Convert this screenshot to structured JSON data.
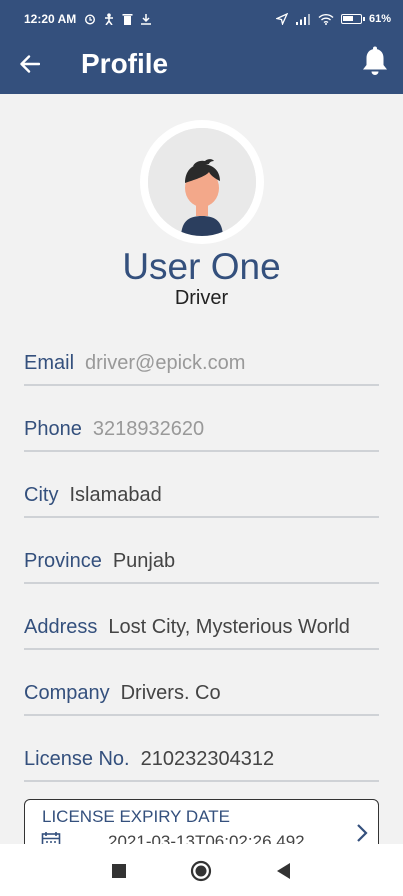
{
  "status_bar": {
    "time": "12:20 AM",
    "battery_percent": "61",
    "battery_level": 0.61,
    "left_icons": [
      "alarm-icon",
      "person-icon",
      "trash-icon",
      "download-icon"
    ],
    "right_icons": [
      "location-icon",
      "signal-icon",
      "wifi-icon",
      "battery-icon"
    ]
  },
  "app_bar": {
    "title": "Profile",
    "back_icon": "arrow-left-icon",
    "notification_icon": "bell-icon",
    "color": "#34507d"
  },
  "profile": {
    "name": "User One",
    "role": "Driver"
  },
  "fields": [
    {
      "label": "Email",
      "value": "driver@epick.com"
    },
    {
      "label": "Phone",
      "value": "3218932620"
    },
    {
      "label": "City",
      "value": "Islamabad"
    },
    {
      "label": "Province",
      "value": "Punjab"
    },
    {
      "label": "Address",
      "value": "Lost City, Mysterious World"
    },
    {
      "label": "Company",
      "value": "Drivers. Co"
    },
    {
      "label": "License No.",
      "value": "210232304312"
    }
  ],
  "license_expiry": {
    "label": "LICENSE EXPIRY DATE",
    "value": "2021-03-13T06:02:26.492"
  },
  "nav_bar": {
    "icons": [
      "recents-square-icon",
      "home-circle-icon",
      "back-triangle-icon"
    ]
  }
}
